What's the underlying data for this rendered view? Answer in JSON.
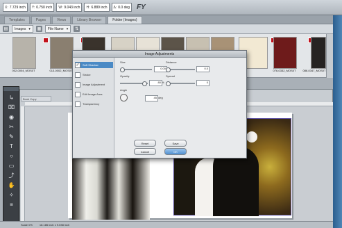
{
  "control_bar": {
    "fields": [
      {
        "label": "X:",
        "value": "7.729 inch"
      },
      {
        "label": "Y:",
        "value": "0.750 inch"
      },
      {
        "label": "W:",
        "value": "9.043 inch"
      },
      {
        "label": "H:",
        "value": "6.889 inch"
      },
      {
        "label": "Δ:",
        "value": "0.0 deg"
      }
    ],
    "fy_mark": "FY"
  },
  "panel_tabs": [
    "Templates",
    "Pages",
    "Views",
    "Library Browser",
    "Folder (Images)"
  ],
  "browser_bar": {
    "source_select": "Images",
    "sort_select": "File Name"
  },
  "thumbnails": [
    {
      "label": "002-0004_MOS0T",
      "color": "#b7b3aa"
    },
    {
      "label": "013-0002_MOS0T",
      "color": "#8a7f70"
    },
    {
      "label": "",
      "color": "#3a332c"
    },
    {
      "label": "",
      "color": "#d7d2c6"
    },
    {
      "label": "",
      "color": "#e7e2d7"
    },
    {
      "label": "",
      "color": "#5c5449"
    },
    {
      "label": "",
      "color": "#c7c0b1"
    },
    {
      "label": "",
      "color": "#a89276"
    },
    {
      "label": "",
      "color": "#f2e9d3"
    },
    {
      "label": "076-0332_MOS0T",
      "color": "#6e1b1b"
    },
    {
      "label": "086-0347_MOS0T",
      "color": "#262322"
    }
  ],
  "tools": [
    "↳",
    "⌧",
    "◉",
    "✂",
    "✎",
    "T",
    "○",
    "▭",
    "⤴",
    "✋",
    "✧",
    "≡"
  ],
  "document": {
    "tab_label": "Book Copy"
  },
  "status_bar": {
    "zoom": "Scale 0%",
    "size": "18.185 inch x 9.038 inch"
  },
  "dialog": {
    "title": "Image Adjustments",
    "options": [
      {
        "label": "Soft Shadow",
        "checked": true
      },
      {
        "label": "Stroke",
        "checked": false
      },
      {
        "label": "Image Adjustment",
        "checked": false
      },
      {
        "label": "Edit Image Area",
        "checked": false
      },
      {
        "label": "Transparency",
        "checked": false
      }
    ],
    "controls": {
      "size_label": "Size",
      "size_value": "0.00",
      "distance_label": "Distance",
      "distance_value": "0.0",
      "opacity_label": "Opacity",
      "opacity_value": "80",
      "opacity_unit": "%",
      "spread_label": "Spread",
      "spread_value": "0",
      "angle_label": "Angle",
      "angle_value": "45",
      "angle_unit": "deg"
    },
    "buttons": {
      "reset": "Reset",
      "save": "Save",
      "cancel": "Cancel",
      "ok": "OK"
    }
  }
}
